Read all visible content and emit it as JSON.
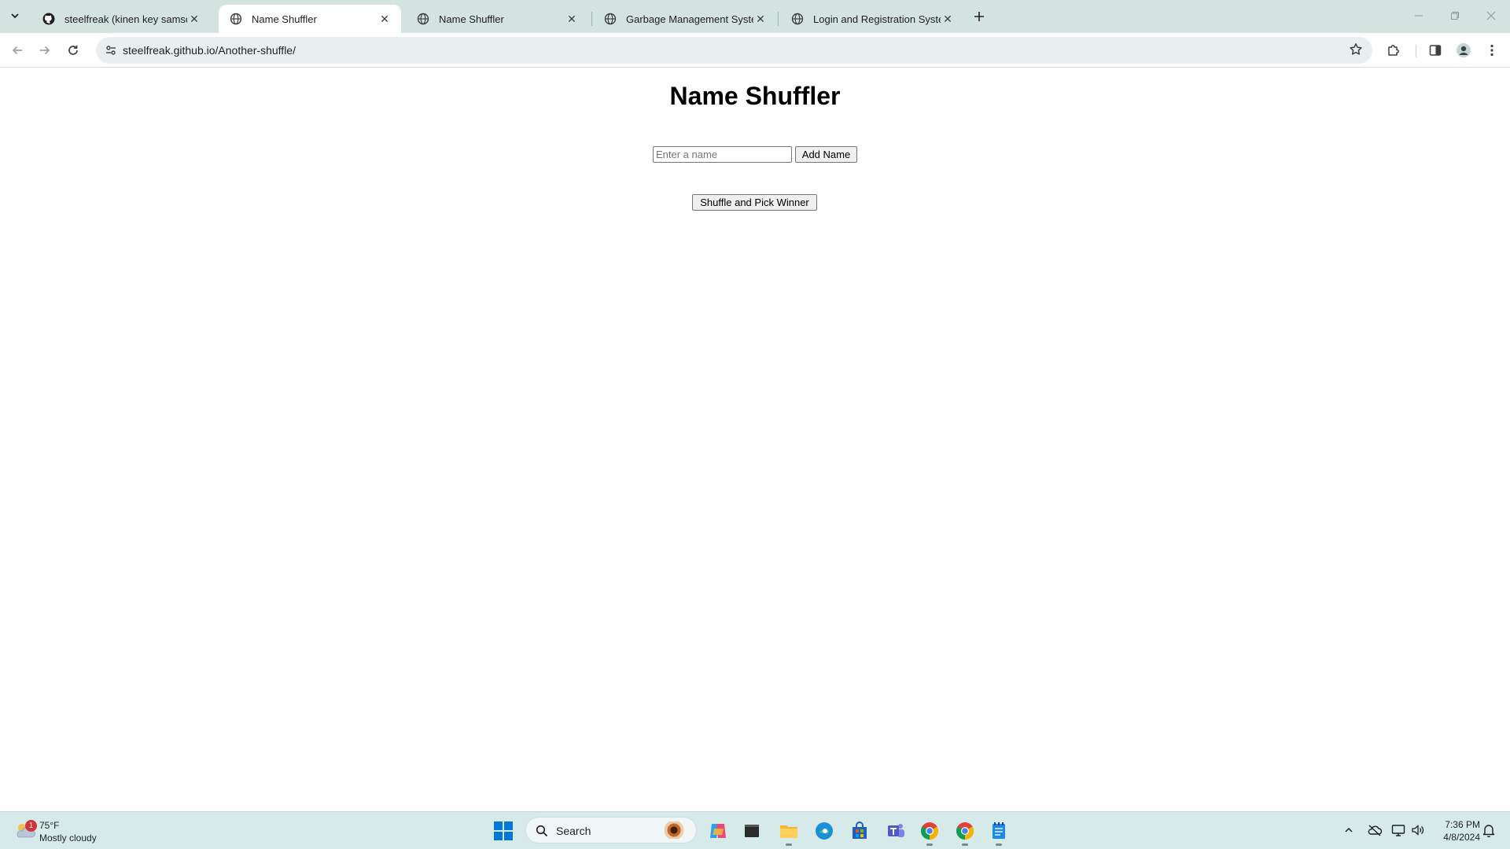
{
  "browser": {
    "tabs": [
      {
        "title": "steelfreak (kinen key samson)",
        "favicon": "github-icon",
        "active": false
      },
      {
        "title": "Name Shuffler",
        "favicon": "globe-icon",
        "active": true
      },
      {
        "title": "Name Shuffler",
        "favicon": "globe-icon",
        "active": false
      },
      {
        "title": "Garbage Management System",
        "favicon": "globe-icon",
        "active": false
      },
      {
        "title": "Login and Registration System",
        "favicon": "globe-icon",
        "active": false
      }
    ],
    "url": "steelfreak.github.io/Another-shuffle/"
  },
  "page": {
    "title": "Name Shuffler",
    "name_input": {
      "placeholder": "Enter a name",
      "value": ""
    },
    "add_button": "Add Name",
    "shuffle_button": "Shuffle and Pick Winner"
  },
  "taskbar": {
    "weather": {
      "temp": "75°F",
      "condition": "Mostly cloudy",
      "badge": "1"
    },
    "search_label": "Search",
    "clock": {
      "time": "7:36 PM",
      "date": "4/8/2024"
    }
  },
  "colors": {
    "tabstrip": "#d3e3e0",
    "taskbar": "#d6ebe9",
    "accent": "#0078d4"
  }
}
